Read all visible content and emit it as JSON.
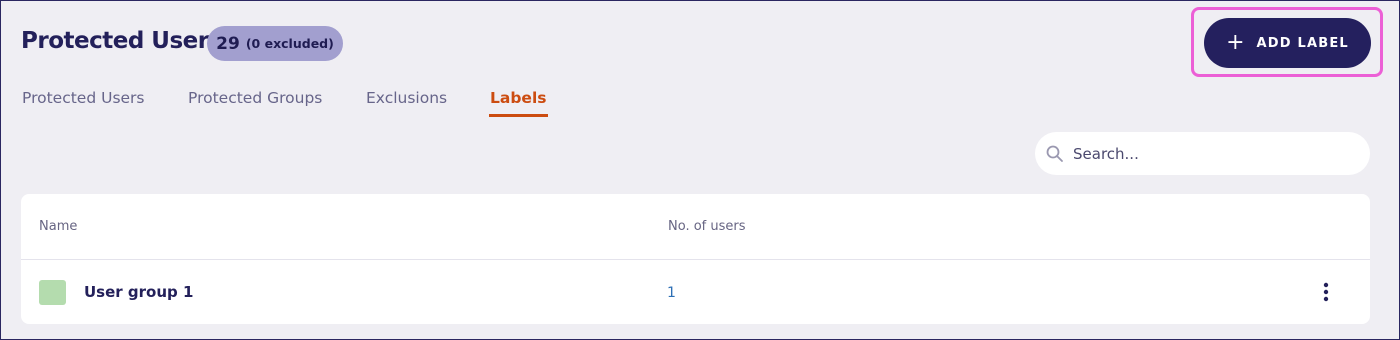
{
  "header": {
    "title": "Protected Users",
    "count": "29",
    "excluded": "(0 excluded)",
    "add_button_label": "ADD LABEL",
    "add_button_icon": "plus-icon"
  },
  "tabs": [
    {
      "label": "Protected Users",
      "active": false
    },
    {
      "label": "Protected Groups",
      "active": false
    },
    {
      "label": "Exclusions",
      "active": false
    },
    {
      "label": "Labels",
      "active": true
    }
  ],
  "search": {
    "placeholder": "Search...",
    "value": "",
    "icon": "search-icon"
  },
  "table": {
    "columns": [
      "Name",
      "No. of users"
    ],
    "rows": [
      {
        "name": "User group 1",
        "users": "1",
        "color": "#b4dcae"
      }
    ]
  },
  "colors": {
    "accent": "#cc4c10",
    "primary_button": "#24205e",
    "badge": "#a29fcf",
    "highlight": "#ec5fd6",
    "link": "#2d6fb5"
  }
}
